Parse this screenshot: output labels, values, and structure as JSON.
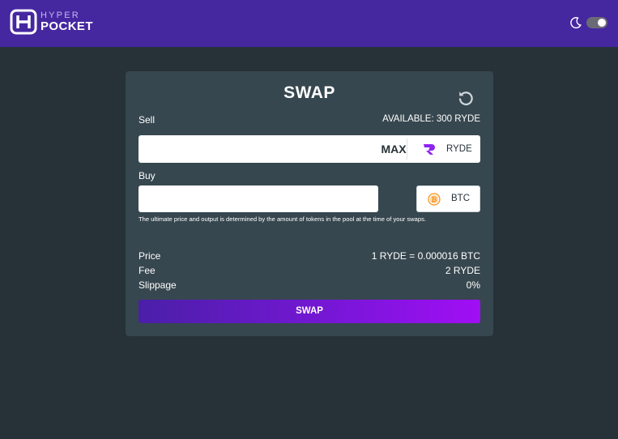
{
  "brand": {
    "line1": "HYPER",
    "line2": "POCKET",
    "logo_icon": "hyper-pocket-logo-icon"
  },
  "header": {
    "theme_icon": "moon-icon",
    "dark_mode_enabled": true
  },
  "swap": {
    "title": "SWAP",
    "refresh_icon": "refresh-icon",
    "sell_label": "Sell",
    "available_text": "AVAILABLE: 300 RYDE",
    "sell_value": "",
    "max_label": "MAX",
    "sell_token": {
      "symbol": "RYDE",
      "icon": "ryde-token-icon"
    },
    "buy_label": "Buy",
    "buy_value": "",
    "buy_token": {
      "symbol": "BTC",
      "icon": "bitcoin-icon"
    },
    "notice": "The ultimate price and output is determined by the amount of tokens in the pool at the time of your swaps.",
    "details": [
      {
        "label": "Price",
        "value": "1 RYDE = 0.000016 BTC"
      },
      {
        "label": "Fee",
        "value": "2 RYDE"
      },
      {
        "label": "Slippage",
        "value": "0%"
      }
    ],
    "submit_label": "SWAP"
  },
  "colors": {
    "page_background": "#263238",
    "header_background": "#4527a0",
    "card_background": "#37474f",
    "button_gradient_start": "#4a1fa8",
    "button_gradient_end": "#a10ef5",
    "ryde_accent": "#8e24f0",
    "bitcoin_accent": "#f7931a"
  }
}
